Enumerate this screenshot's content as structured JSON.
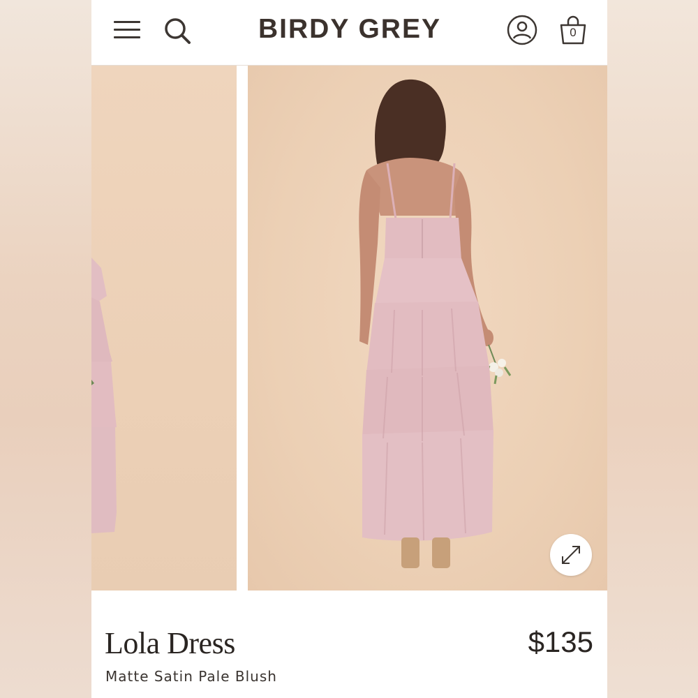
{
  "header": {
    "brand": "BIRDY GREY",
    "cart_count": "0",
    "icons": [
      "hamburger-menu-icon",
      "search-icon",
      "account-icon",
      "shopping-bag-icon"
    ]
  },
  "gallery": {
    "images": [
      "dress-side-view-partial",
      "dress-back-view"
    ],
    "expand_icon": "expand-arrows-icon"
  },
  "product": {
    "name": "Lola Dress",
    "price": "$135",
    "variant": "Matte Satin Pale Blush"
  },
  "colors": {
    "brand_text": "#3b322d",
    "backdrop": "#ecd0b5",
    "dress_blush": "#e3bfc4"
  }
}
